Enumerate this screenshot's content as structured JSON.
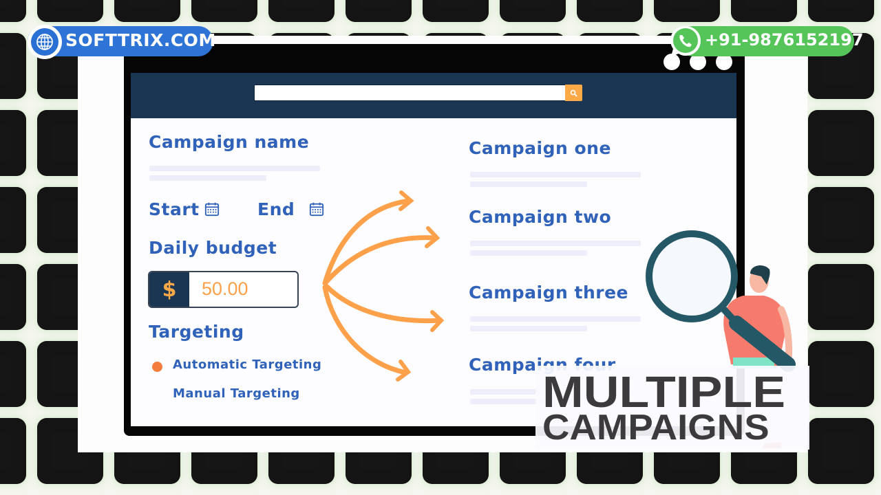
{
  "branding": {
    "website": "SOFTTRIX.COM",
    "website_icon": "globe-icon",
    "phone": "+91-9876152197",
    "phone_icon": "whatsapp-icon",
    "colors": {
      "website_badge": "#2e73d6",
      "phone_badge": "#55c55a"
    }
  },
  "browser": {
    "search": {
      "value": "",
      "placeholder": "",
      "button_icon": "search-icon"
    },
    "colors": {
      "nav_bar": "#1b3652",
      "accent": "#fca947",
      "label": "#2f62b8"
    }
  },
  "form": {
    "campaign_name_label": "Campaign name",
    "start_label": "Start",
    "end_label": "End",
    "daily_budget_label": "Daily budget",
    "currency_symbol": "$",
    "daily_budget_value": "50.00",
    "targeting_label": "Targeting",
    "targeting_options": [
      {
        "label": "Automatic Targeting",
        "selected": true
      },
      {
        "label": "Manual Targeting",
        "selected": false
      }
    ]
  },
  "campaigns": [
    {
      "name": "Campaign one"
    },
    {
      "name": "Campaign two"
    },
    {
      "name": "Campaign three"
    },
    {
      "name": "Campaign four"
    }
  ],
  "overlay_title": {
    "line1": "MULTIPLE",
    "line2": "CAMPAIGNS"
  }
}
